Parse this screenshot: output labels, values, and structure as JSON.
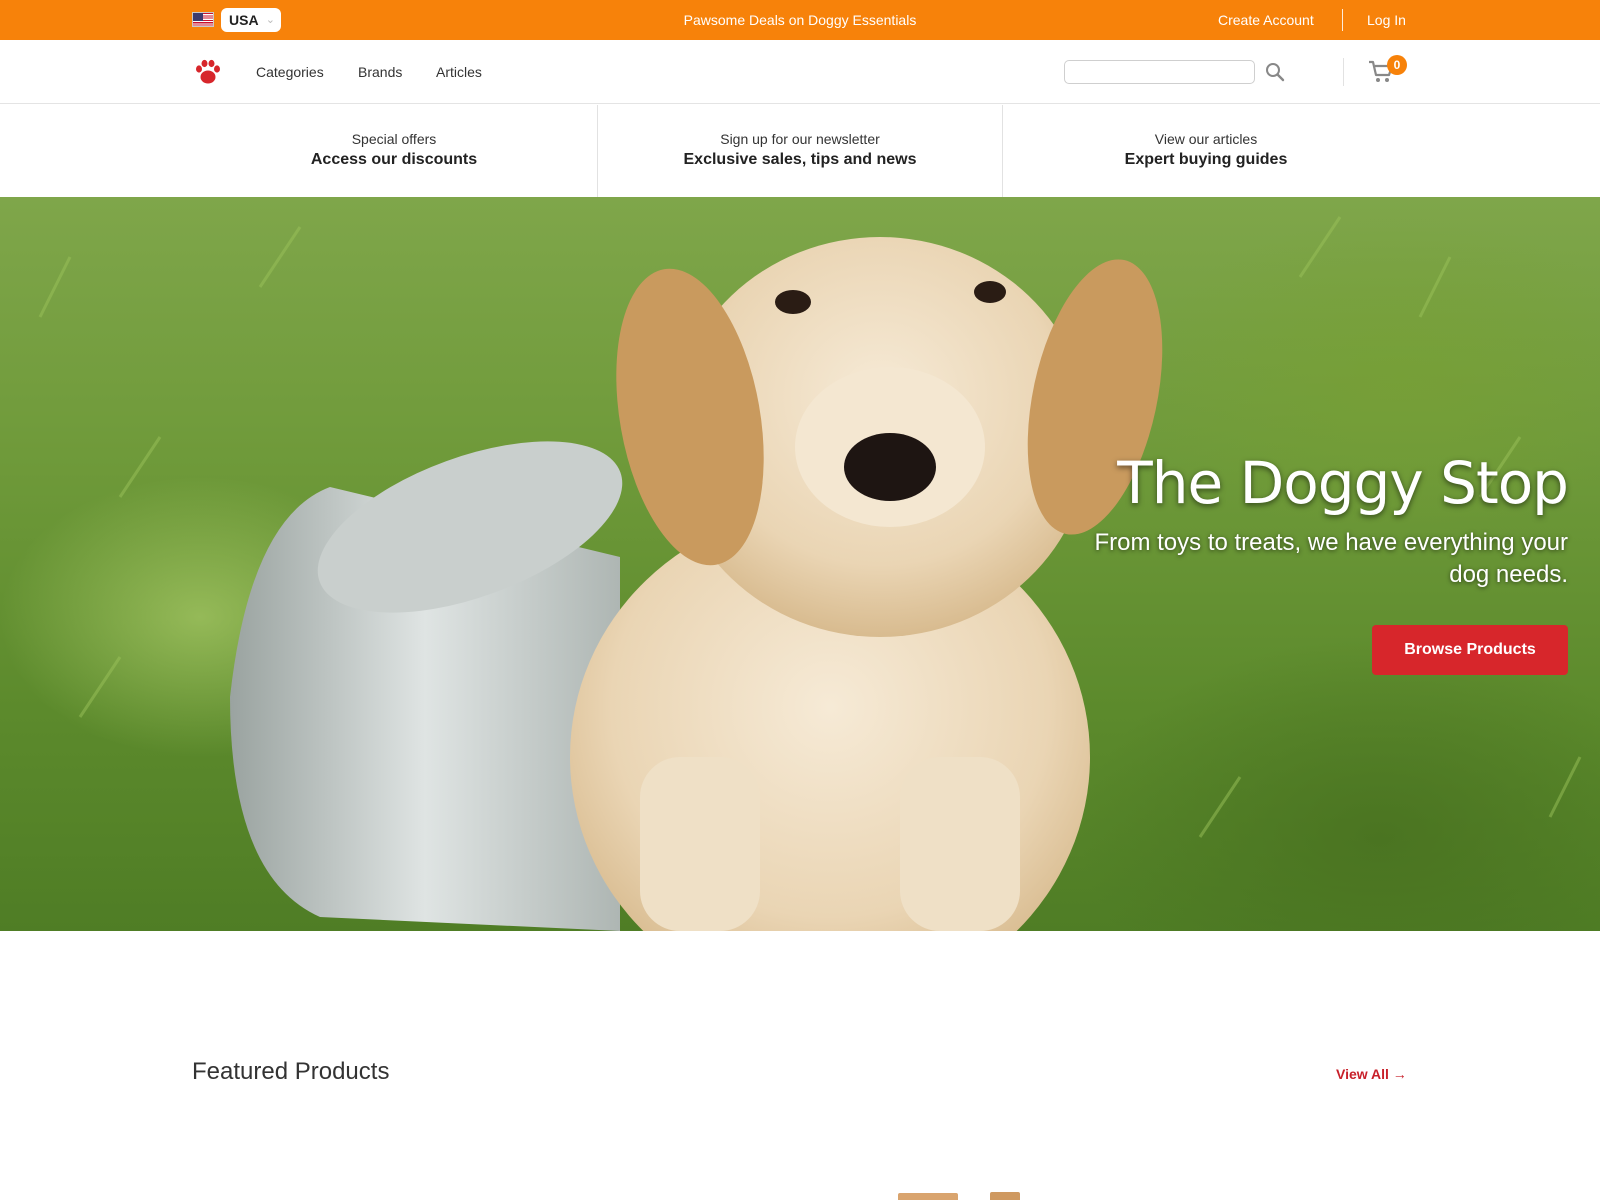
{
  "topbar": {
    "country": "USA",
    "promo": "Pawsome Deals on Doggy Essentials",
    "create_account": "Create Account",
    "log_in": "Log In",
    "bg_color": "#f7820a"
  },
  "nav": {
    "links": [
      "Categories",
      "Brands",
      "Articles"
    ],
    "search_placeholder": "",
    "cart_count": "0",
    "logo_icon": "paw-icon",
    "search_icon": "search-icon",
    "cart_icon": "cart-icon"
  },
  "strip": [
    {
      "sub": "Special offers",
      "main": "Access our discounts"
    },
    {
      "sub": "Sign up for our newsletter",
      "main": "Exclusive sales, tips and news"
    },
    {
      "sub": "View our articles",
      "main": "Expert buying guides"
    }
  ],
  "hero": {
    "title": "The Doggy Stop",
    "subtitle": "From toys to treats, we have everything your dog needs.",
    "button": "Browse Products",
    "button_color": "#d7262b"
  },
  "featured": {
    "title": "Featured Products",
    "view_all": "View All →",
    "link_color": "#c8202a"
  }
}
